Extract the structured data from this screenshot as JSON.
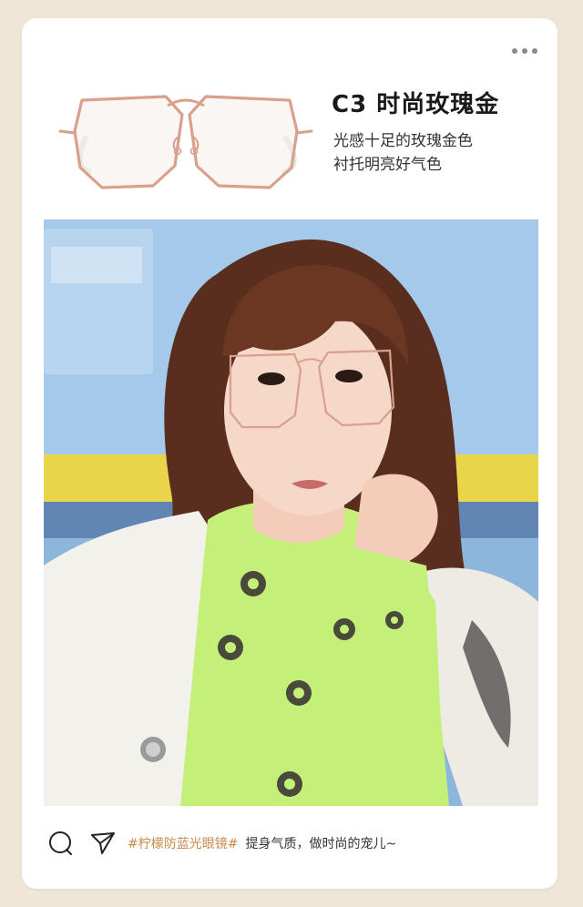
{
  "product": {
    "title": "C3 时尚玫瑰金",
    "desc_line1": "光感十足的玫瑰金色",
    "desc_line2": "衬托明亮好气色"
  },
  "footer": {
    "hashtag": "#柠檬防蓝光眼镜#",
    "caption": "提身气质，做时尚的宠儿~"
  },
  "icons": {
    "more": "more-dots-icon",
    "comment": "comment-icon",
    "share": "send-icon"
  },
  "colors": {
    "frame": "#d9a08c",
    "hashtag": "#c98a4a",
    "background": "#efe6d8"
  }
}
